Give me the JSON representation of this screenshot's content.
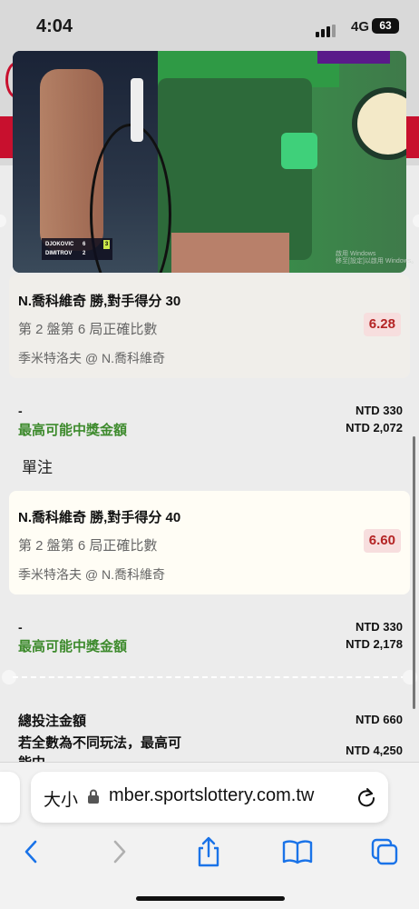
{
  "status": {
    "time": "4:04",
    "network": "4G",
    "battery": "63"
  },
  "video": {
    "score_players": [
      "DJOKOVIC",
      "DIMITROV"
    ],
    "score_games": [
      "6",
      "2"
    ],
    "score_points": [
      "3",
      "1"
    ],
    "watermark_line1": "啟用 Windows",
    "watermark_line2": "移至[設定]以啟用 Windows。"
  },
  "bets": [
    {
      "title": "N.喬科維奇 勝,對手得分 30",
      "market": "第 2 盤第 6 局正確比數",
      "match": "季米特洛夫 @ N.喬科維奇",
      "odds": "6.28",
      "stake_prefix": "-",
      "stake": "NTD 330",
      "prize_label": "最高可能中獎金額",
      "prize": "NTD 2,072"
    },
    {
      "title": "N.喬科維奇 勝,對手得分 40",
      "market": "第 2 盤第 6 局正確比數",
      "match": "季米特洛夫 @ N.喬科維奇",
      "odds": "6.60",
      "stake_prefix": "-",
      "stake": "NTD 330",
      "prize_label": "最高可能中獎金額",
      "prize": "NTD 2,178"
    }
  ],
  "single_label": "單注",
  "summary": {
    "total_label": "總投注金額",
    "total_value": "NTD 660",
    "max_label": "若全數為不同玩法，最高可",
    "max_label_cont": "能中",
    "max_value": "NTD 4,250"
  },
  "browser": {
    "aa_label": "大小",
    "url": "mber.sportslottery.com.tw"
  }
}
